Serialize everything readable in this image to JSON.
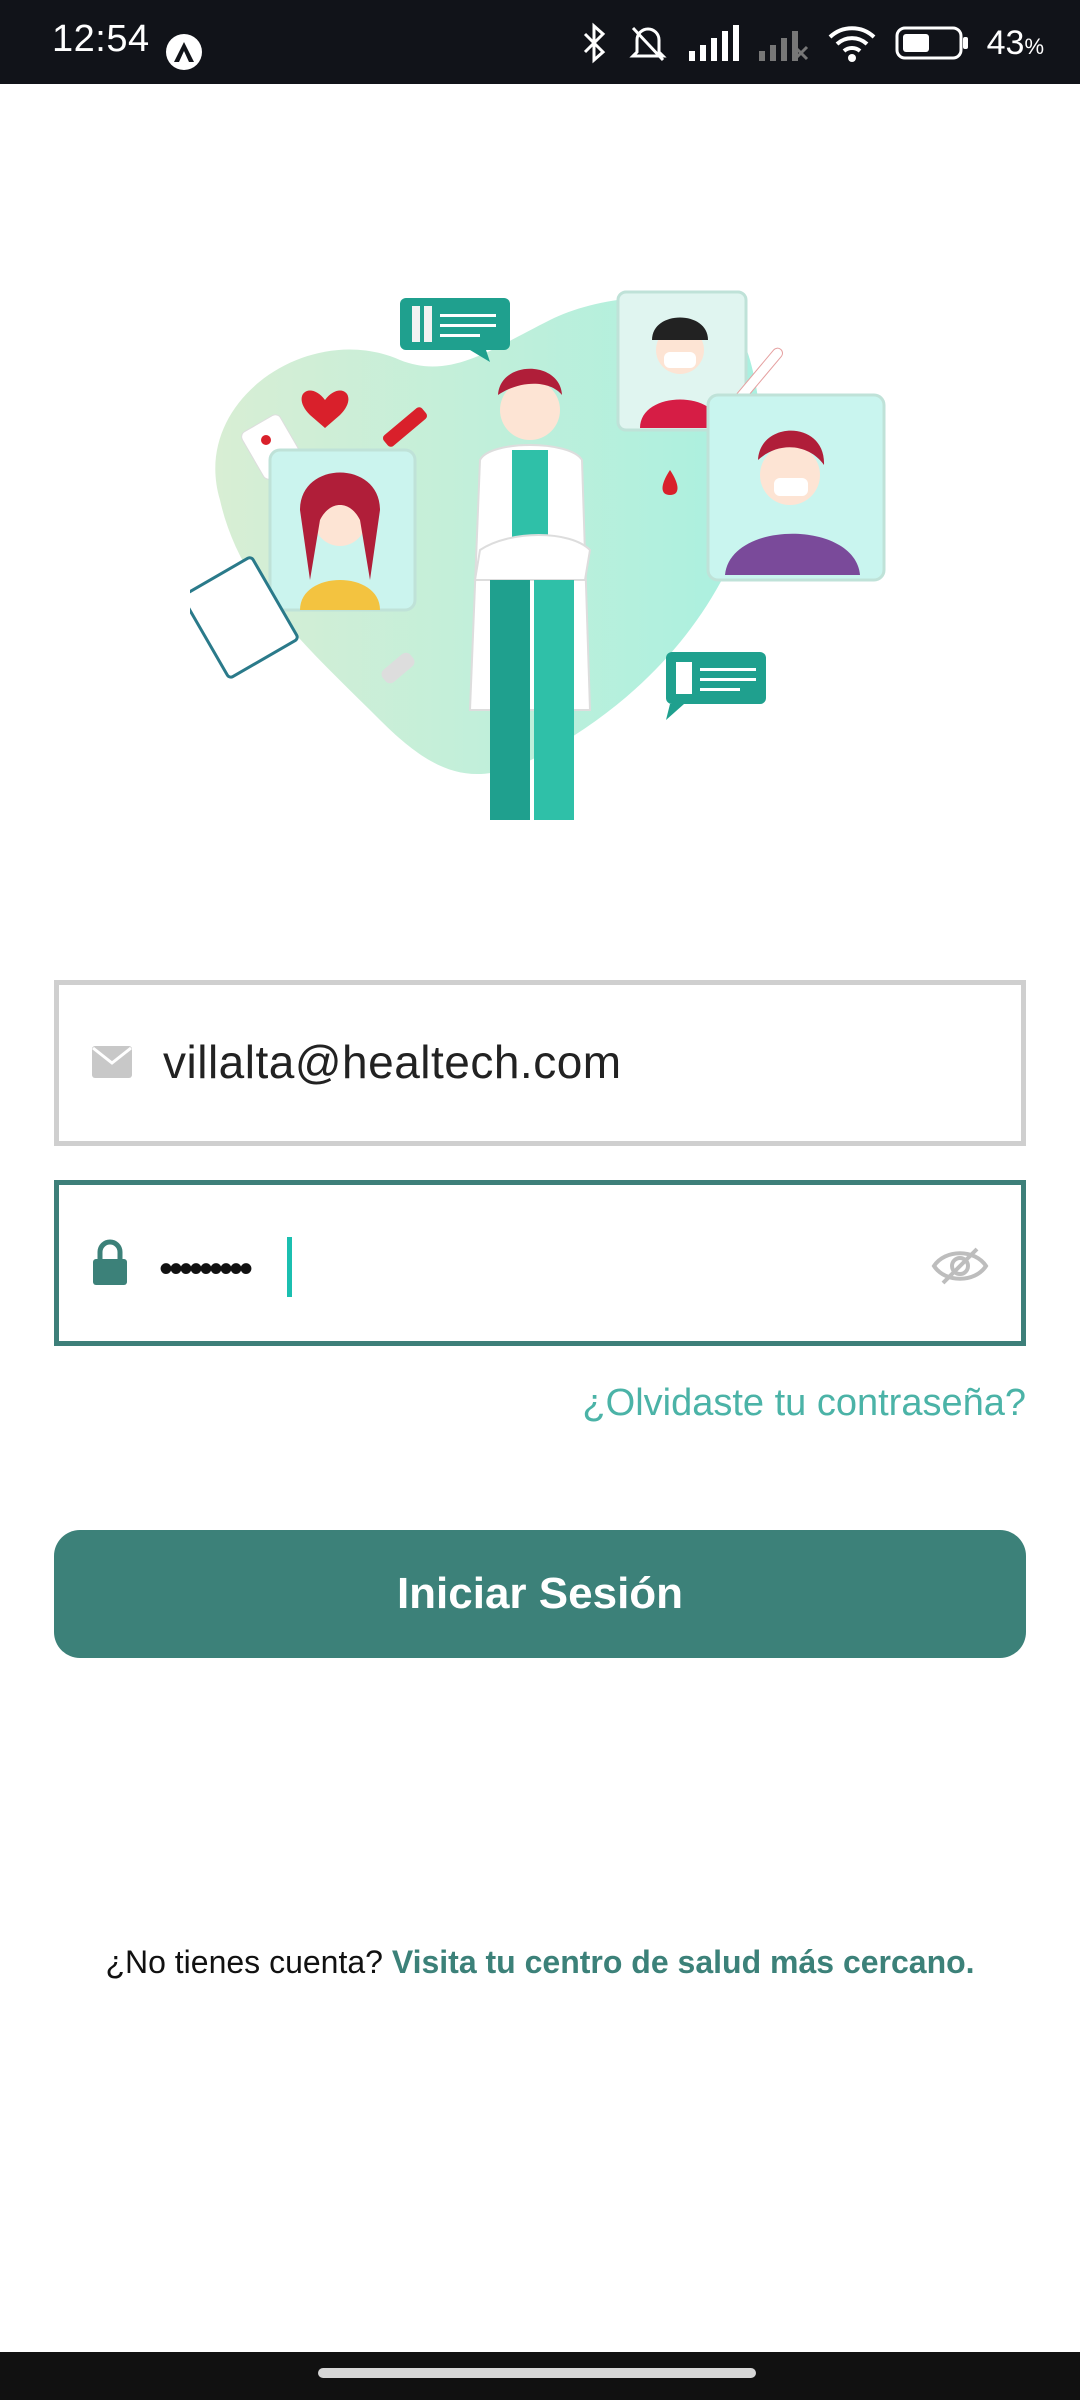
{
  "status_bar": {
    "time": "12:54",
    "battery_percent": "43",
    "battery_unit": "%",
    "icons": [
      "app-icon",
      "bluetooth-icon",
      "mute-icon",
      "signal-icon",
      "signal-off-icon",
      "wifi-icon",
      "battery-icon"
    ]
  },
  "login": {
    "email_value": "villalta@healtech.com",
    "password_value": "•••••••••",
    "forgot_password": "¿Olvidaste tu contraseña?",
    "submit_label": "Iniciar Sesión",
    "no_account_text": "¿No tienes cuenta?",
    "no_account_link": "Visita tu centro de salud más cercano."
  },
  "colors": {
    "brand": "#3c8179",
    "accent": "#4bb3a7",
    "field_border": "#cfcfcf"
  }
}
